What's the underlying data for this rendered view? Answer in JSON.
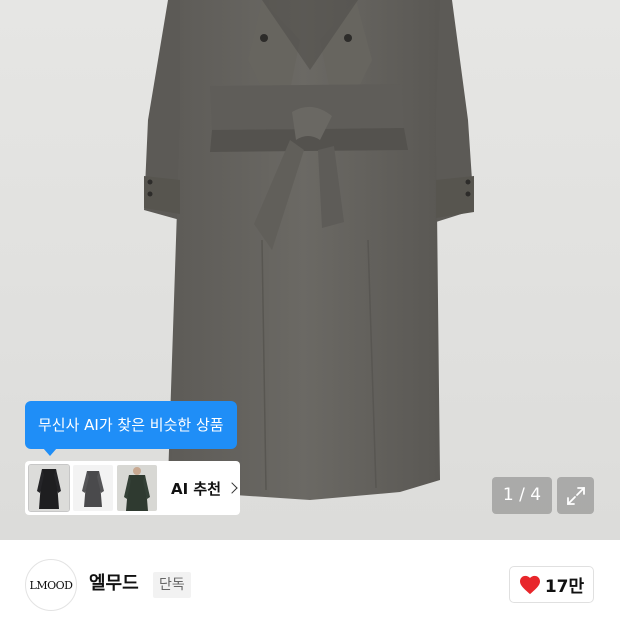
{
  "product_image": {
    "alt_icon": "coat-photo",
    "counter": "1 / 4"
  },
  "ai_recommend": {
    "tooltip": "무신사 AI가 찾은 비슷한 상품",
    "label": "AI 추천",
    "thumbnails": [
      "black-coat-thumb",
      "gray-coat-thumb",
      "green-coat-thumb"
    ],
    "accent_color": "#1f8ef7"
  },
  "brand": {
    "logo_text": "LMOOD",
    "name": "엘무드",
    "badge": "단독"
  },
  "like": {
    "count": "17만",
    "heart_color": "#e8262b"
  },
  "icons": {
    "expand": "expand-icon",
    "heart": "heart-icon",
    "chevron": "chevron-right-icon"
  }
}
